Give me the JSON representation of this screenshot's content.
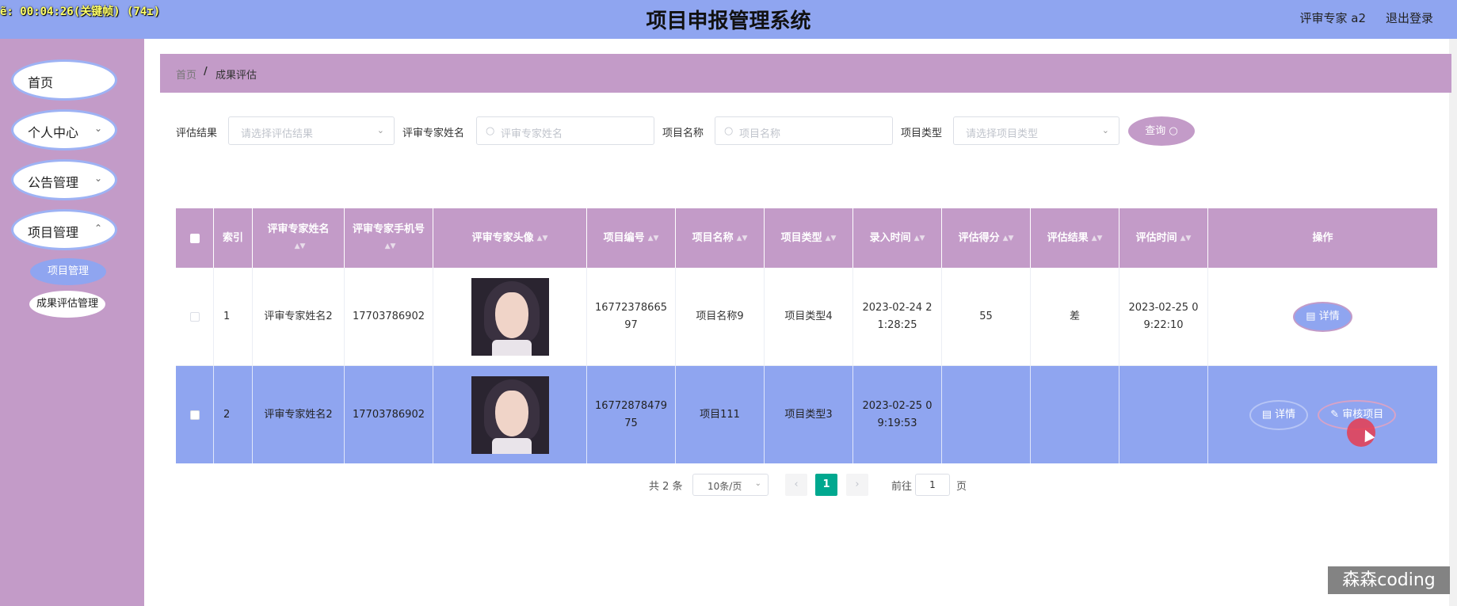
{
  "recording": {
    "timer_text": "ẽ: 00:04:26(关键帧) (74ɪ)"
  },
  "header": {
    "title": "项目申报管理系统",
    "user": "评审专家 a2",
    "logout": "退出登录"
  },
  "sidebar": {
    "items": [
      {
        "label": "首页",
        "has_arrow": false
      },
      {
        "label": "个人中心",
        "has_arrow": true
      },
      {
        "label": "公告管理",
        "has_arrow": true
      },
      {
        "label": "项目管理",
        "has_arrow": true
      }
    ],
    "sub_items": [
      {
        "label": "项目管理",
        "active": true
      },
      {
        "label": "成果评估管理",
        "active": false
      }
    ]
  },
  "breadcrumb": {
    "home": "首页",
    "separator": "/",
    "current": "成果评估"
  },
  "filters": {
    "result_label": "评估结果",
    "result_placeholder": "请选择评估结果",
    "expert_label": "评审专家姓名",
    "expert_placeholder": "评审专家姓名",
    "project_label": "项目名称",
    "project_placeholder": "项目名称",
    "type_label": "项目类型",
    "type_placeholder": "请选择项目类型",
    "query_button": "查询"
  },
  "table": {
    "headers": [
      "索引",
      "评审专家姓名",
      "评审专家手机号",
      "评审专家头像",
      "项目编号",
      "项目名称",
      "项目类型",
      "录入时间",
      "评估得分",
      "评估结果",
      "评估时间",
      "操作"
    ],
    "rows": [
      {
        "index": "1",
        "expert_name": "评审专家姓名2",
        "phone": "17703786902",
        "project_no": "1677237866597",
        "project_name": "项目名称9",
        "project_type": "项目类型4",
        "entry_time": "2023-02-24 21:28:25",
        "score": "55",
        "result": "差",
        "eval_time": "2023-02-25 09:22:10",
        "actions": [
          "详情"
        ]
      },
      {
        "index": "2",
        "expert_name": "评审专家姓名2",
        "phone": "17703786902",
        "project_no": "1677287847975",
        "project_name": "项目111",
        "project_type": "项目类型3",
        "entry_time": "2023-02-25 09:19:53",
        "score": "",
        "result": "",
        "eval_time": "",
        "actions": [
          "详情",
          "审核项目"
        ]
      }
    ]
  },
  "pagination": {
    "total": "共 2 条",
    "page_size": "10条/页",
    "current_page": "1",
    "goto_label": "前往",
    "goto_value": "1",
    "page_suffix": "页"
  },
  "watermark": "森森coding",
  "colors": {
    "primary_blue": "#8fa5f0",
    "primary_purple": "#c39bc8",
    "page_active": "#00a88f"
  }
}
